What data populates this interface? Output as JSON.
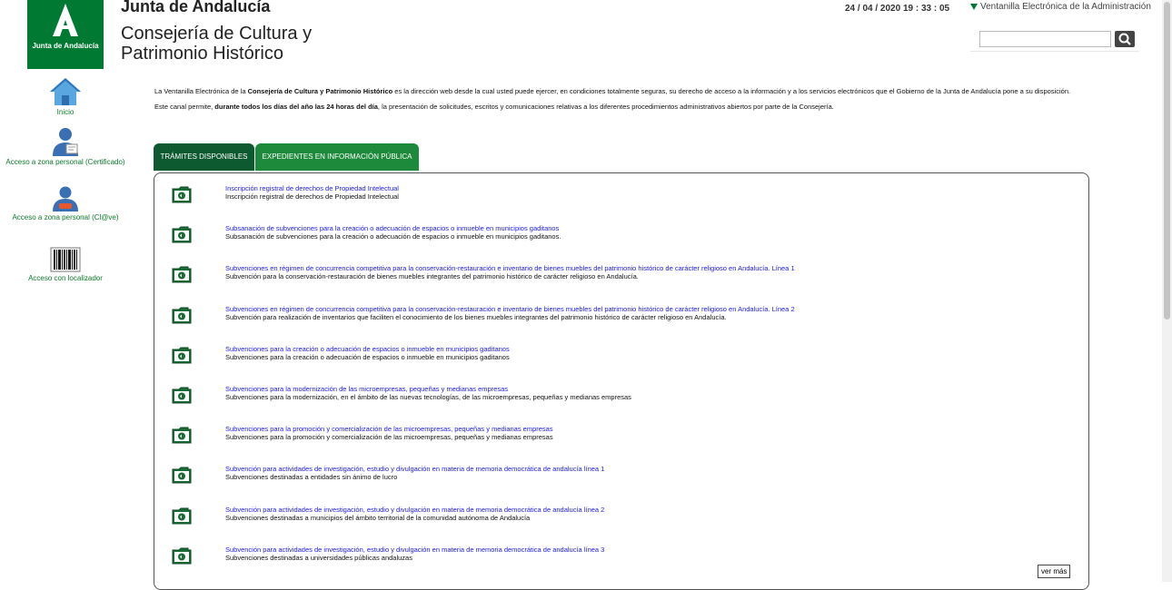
{
  "header": {
    "logo_text": "Junta de Andalucía",
    "org_name": "Junta de Andalucía",
    "dept_name": "Consejería de Cultura y Patrimonio Histórico",
    "datetime": "24 / 04 / 2020   19 : 33 : 05",
    "ventanilla": "Ventanilla Electrónica de la Administración",
    "search_placeholder": ""
  },
  "nav": {
    "items": [
      {
        "label": "Inicio",
        "icon": "home-icon"
      },
      {
        "label": "Acceso a zona personal (Certificado)",
        "icon": "user-certificate-icon"
      },
      {
        "label": "Acceso a zona personal (Cl@ve)",
        "icon": "user-clave-icon"
      },
      {
        "label": "Acceso con localizador",
        "icon": "barcode-icon"
      }
    ]
  },
  "intro": {
    "p1_a": "La Ventanilla Electrónica de la ",
    "p1_b": "Consejería de Cultura y Patrimonio Histórico",
    "p1_c": " es la dirección web desde la cual usted puede ejercer, en condiciones totalmente seguras, su derecho de acceso a la información y a los servicios electrónicos que el Gobierno de la Junta de Andalucía pone a su disposición.",
    "p2_a": "Este canal permite, ",
    "p2_b": "durante todos los días del año las 24 horas del día",
    "p2_c": ", la presentación de solicitudes, escritos y comunicaciones relativas a los diferentes procedimientos administrativos abiertos por parte de la Consejería."
  },
  "tabs": [
    {
      "label": "TRÁMITES DISPONIBLES"
    },
    {
      "label": "EXPEDIENTES EN INFORMACIÓN PÚBLICA"
    }
  ],
  "procedures": [
    {
      "title": "Inscripción registral de derechos de Propiedad Intelectual",
      "desc": "Inscripción registral de derechos de Propiedad Intelectual"
    },
    {
      "title": "Subsanación de subvenciones para la creación o adecuación de espacios o inmueble en municipios gaditanos",
      "desc": "Subsanación de subvenciones para la creación o adecuación de espacios o inmueble en municipios gaditanos."
    },
    {
      "title": "Subvenciones en régimen de concurrencia competitiva para la conservación-restauración e inventario de bienes muebles del patrimonio histórico de carácter religioso en Andalucía. Línea 1",
      "desc": "Subvención para la conservación-restauración de bienes muebles integrantes del patrimonio histórico de carácter religioso en Andalucía."
    },
    {
      "title": "Subvenciones en régimen de concurrencia competitiva para la conservación-restauración e inventario de bienes muebles del patrimonio histórico de carácter religioso en Andalucía. Línea 2",
      "desc": "Subvención para realización de inventarios que faciliten el conocimiento de los bienes muebles integrantes del patrimonio histórico de carácter religioso en Andalucía."
    },
    {
      "title": "Subvenciones para la creación o adecuación de espacios o inmueble en municipios gaditanos",
      "desc": "Subvenciones para la creación o adecuación de espacios o inmueble en municipios gaditanos"
    },
    {
      "title": "Subvenciones para la modernización de las microempresas, pequeñas y medianas empresas",
      "desc": "Subvenciones para la modernización, en el ámbito de las nuevas tecnologías, de las microempresas, pequeñas y medianas empresas"
    },
    {
      "title": "Subvenciones para la promoción y comercialización de las microempresas, pequeñas y medianas empresas",
      "desc": "Subvenciones para la promoción y comercialización de las microempresas, pequeñas y medianas empresas"
    },
    {
      "title": "Subvención para actividades de investigación, estudio y divulgación en materia de memoria democrática de andalucía línea 1",
      "desc": "Subvenciones destinadas a entidades sin ánimo de lucro"
    },
    {
      "title": "Subvención para actividades de investigación, estudio y divulgación en materia de memoria democrática de andalucía línea 2",
      "desc": "Subvenciones destinadas a municipios del ámbito territorial de la comunidad autónoma de Andalucía"
    },
    {
      "title": "Subvención para actividades de investigación, estudio y divulgación en materia de memoria democrática de andalucía línea 3",
      "desc": "Subvenciones destinadas a universidades públicas andaluzas"
    }
  ],
  "ver_mas": "ver más",
  "colors": {
    "brand_green": "#007a33",
    "tab_active": "#0d5a30",
    "tab_inactive": "#1c8a3a",
    "link_blue": "#1a1aee"
  }
}
